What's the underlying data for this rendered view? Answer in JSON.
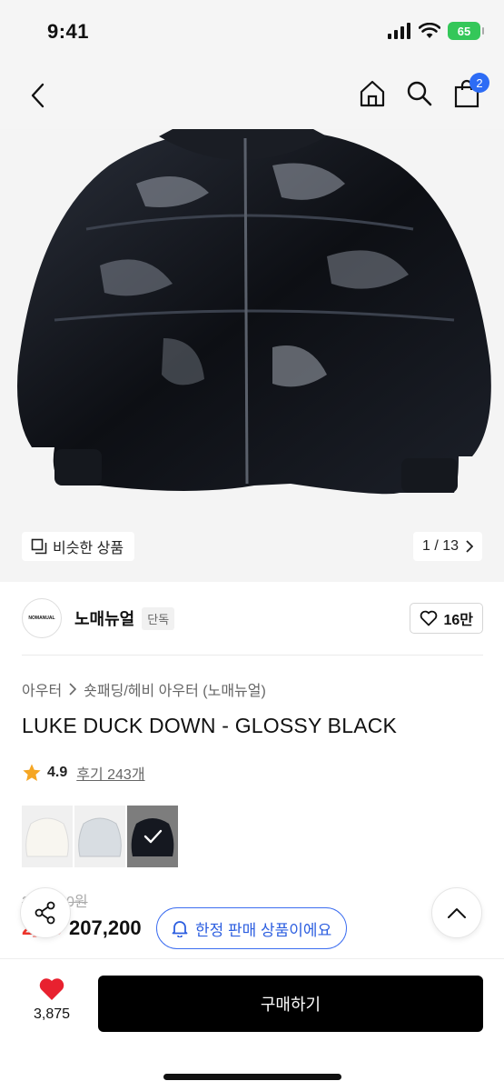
{
  "status": {
    "time": "9:41",
    "battery": "65"
  },
  "nav": {
    "cart_count": "2"
  },
  "hero": {
    "similar_label": "비슷한 상품",
    "counter": "1 / 13"
  },
  "brand": {
    "logo_text": "NOMANUAL",
    "name": "노매뉴얼",
    "tag": "단독",
    "likes": "16만"
  },
  "product": {
    "breadcrumb": [
      "아우터",
      "숏패딩/헤비 아우터 (노매뉴얼)"
    ],
    "title": "LUKE DUCK DOWN - GLOSSY BLACK",
    "rating": "4.9",
    "reviews": "후기 243개",
    "swatches": [
      "ivory",
      "light-gray",
      "glossy-black"
    ],
    "original_price": "3__,_00원",
    "discount": "2_%",
    "price": "207,200"
  },
  "limited": {
    "label": "한정 판매 상품이에요"
  },
  "bottom": {
    "like_count": "3,875",
    "buy_label": "구매하기"
  },
  "colors": {
    "accent_blue": "#2d6cf5",
    "discount_red": "#f0352c",
    "heart_red": "#e8212f",
    "battery_green": "#34c759"
  }
}
